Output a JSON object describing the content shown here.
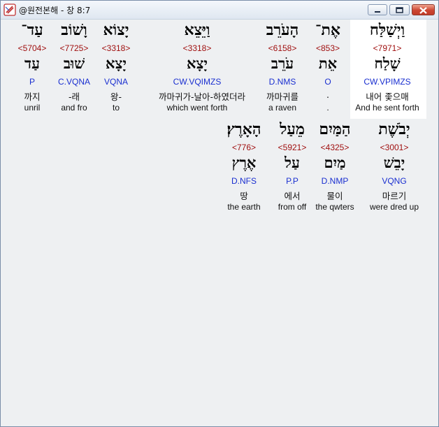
{
  "window": {
    "title": "@원전본해 - 창 8:7",
    "buttons": {
      "minimize": "minimize-icon",
      "maximize": "maximize-icon",
      "close": "close-icon"
    }
  },
  "verse": {
    "line1": [
      {
        "heb": "וַיְשַׁלַּח",
        "strong": "<7971>",
        "lemma": "שָׁלַח",
        "parse": "CW.VPIMZS",
        "kor": "내어 좇으매",
        "eng": "And he sent forth",
        "selected": true
      },
      {
        "heb": "אֶת־",
        "strong": "<853>",
        "lemma": "אֵת",
        "parse": "O",
        "kor": ".",
        "eng": "."
      },
      {
        "heb": "הָעֹרֵב",
        "strong": "<6158>",
        "lemma": "עֹרֵב",
        "parse": "D.NMS",
        "kor": "까마귀를",
        "eng": "a raven"
      },
      {
        "heb": "וַיֵּצֵא",
        "strong": "<3318>",
        "lemma": "יָצָא",
        "parse": "CW.VQIMZS",
        "kor": "까마귀가-날아-하였더라",
        "eng": "which went forth"
      },
      {
        "heb": "יָצוֹא",
        "strong": "<3318>",
        "lemma": "יָצָא",
        "parse": "VQNA",
        "kor": "왕-",
        "eng": "to"
      },
      {
        "heb": "וָשׁוֹב",
        "strong": "<7725>",
        "lemma": "שׁוּב",
        "parse": "C.VQNA",
        "kor": "-래",
        "eng": "and fro"
      },
      {
        "heb": "עַד־",
        "strong": "<5704>",
        "lemma": "עַד",
        "parse": "P",
        "kor": "까지",
        "eng": "unril"
      }
    ],
    "line2": [
      {
        "heb": "יְבֹשֶׁת",
        "strong": "<3001>",
        "lemma": "יָבֵשׁ",
        "parse": "VQNG",
        "kor": "마르기",
        "eng": "were dred up"
      },
      {
        "heb": "הַמַּיִם",
        "strong": "<4325>",
        "lemma": "מַיִם",
        "parse": "D.NMP",
        "kor": "물이",
        "eng": "the qwters"
      },
      {
        "heb": "מֵעַל",
        "strong": "<5921>",
        "lemma": "עַל",
        "parse": "P.P",
        "kor": "에서",
        "eng": "from off"
      },
      {
        "heb": "הָאָרֶץ׃",
        "strong": "<776>",
        "lemma": "אֶרֶץ",
        "parse": "D.NFS",
        "kor": "땅",
        "eng": "the earth"
      }
    ]
  }
}
